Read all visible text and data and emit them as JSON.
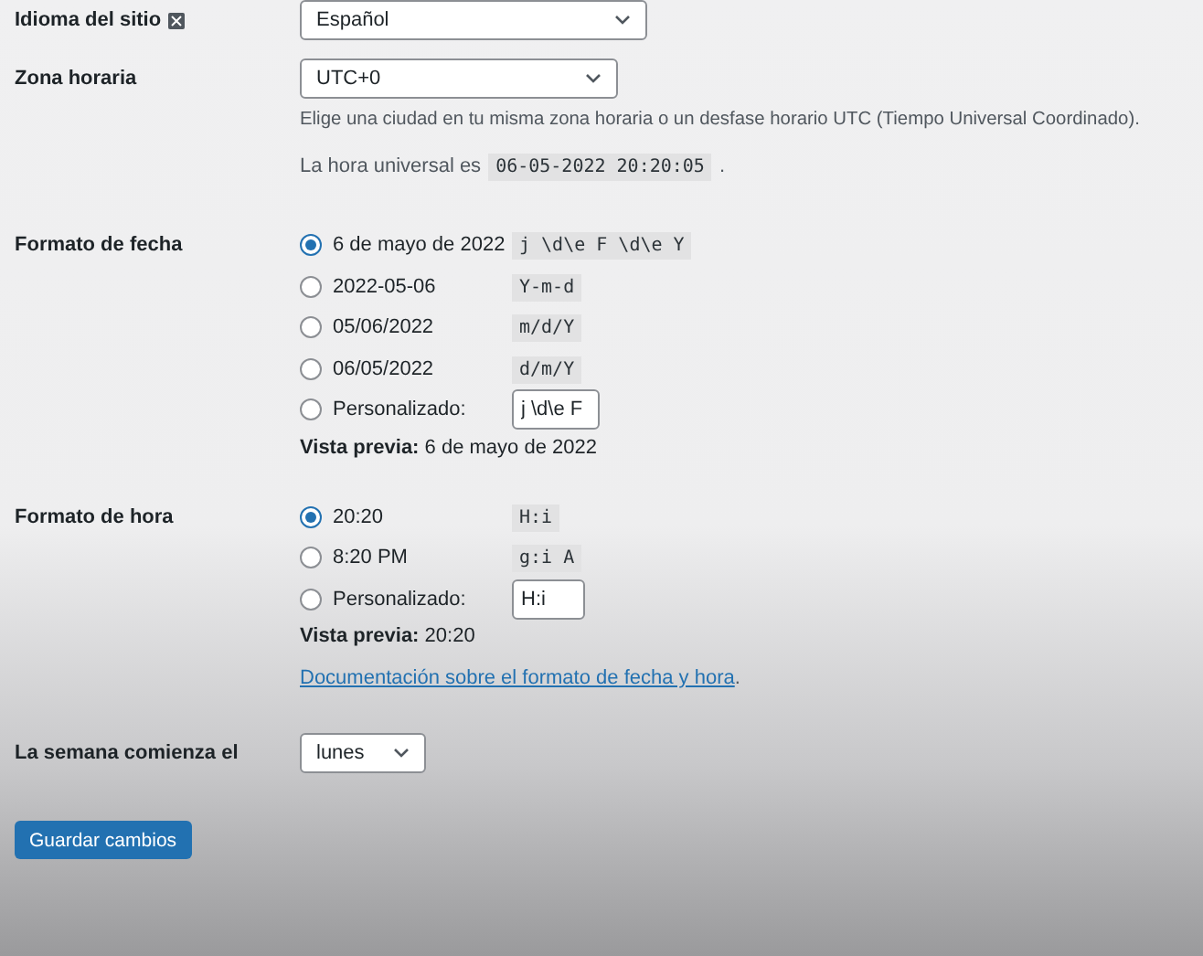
{
  "language": {
    "label": "Idioma del sitio",
    "value": "Español"
  },
  "timezone": {
    "label": "Zona horaria",
    "value": "UTC+0",
    "description": "Elige una ciudad en tu misma zona horaria o un desfase horario UTC (Tiempo Universal Coordinado).",
    "universal_prefix": "La hora universal es",
    "universal_time": "06-05-2022 20:20:05",
    "universal_suffix": "."
  },
  "date_format": {
    "label": "Formato de fecha",
    "options": [
      {
        "kind": "preset",
        "label": "6 de mayo de 2022",
        "code": "j \\d\\e F \\d\\e Y",
        "selected": true
      },
      {
        "kind": "preset",
        "label": "2022-05-06",
        "code": "Y-m-d",
        "selected": false
      },
      {
        "kind": "preset",
        "label": "05/06/2022",
        "code": "m/d/Y",
        "selected": false
      },
      {
        "kind": "preset",
        "label": "06/05/2022",
        "code": "d/m/Y",
        "selected": false
      },
      {
        "kind": "custom",
        "label": "Personalizado:",
        "code": "j \\d\\e F",
        "selected": false
      }
    ],
    "preview": "**Vista previa:** 6 de mayo de 2022"
  },
  "time_format": {
    "label": "Formato de hora",
    "options": [
      {
        "kind": "preset",
        "label": "20:20",
        "code": "H:i",
        "selected": true
      },
      {
        "kind": "preset",
        "label": "8:20 PM",
        "code": "g:i A",
        "selected": false
      },
      {
        "kind": "custom",
        "label": "Personalizado:",
        "code": "H:i",
        "selected": false
      }
    ],
    "preview": "**Vista previa:** 20:20",
    "doc_link": "Documentación sobre el formato de fecha y hora",
    "doc_suffix": "."
  },
  "week_start": {
    "label": "La semana comienza el",
    "value": "lunes"
  },
  "save_button": "Guardar cambios"
}
